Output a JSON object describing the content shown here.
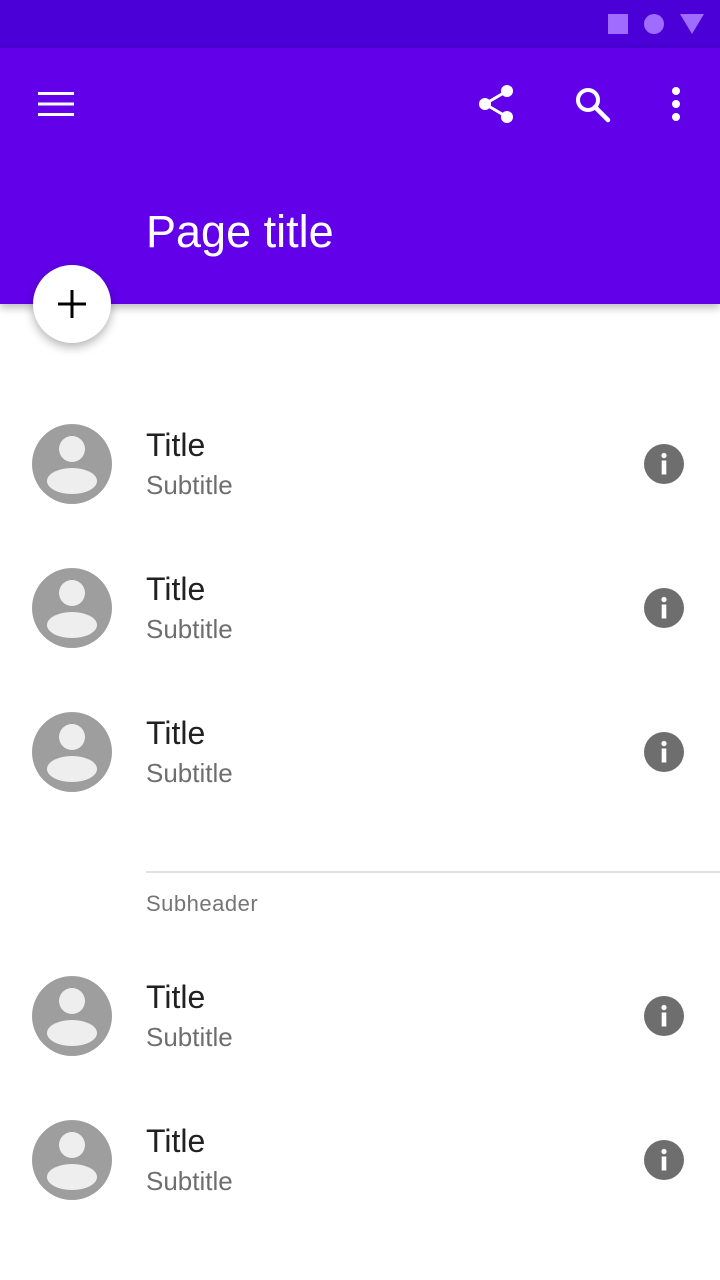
{
  "app_bar": {
    "title": "Page title",
    "background": "#6200ea",
    "icons": [
      "menu-icon",
      "share-icon",
      "search-icon",
      "more-vert-icon"
    ]
  },
  "status_bar": {
    "background": "#4a00d6",
    "icons": [
      "square-icon",
      "circle-icon",
      "triangle-icon"
    ]
  },
  "fab": {
    "icon": "add-icon"
  },
  "list": {
    "items": [
      {
        "title": "Title",
        "subtitle": "Subtitle"
      },
      {
        "title": "Title",
        "subtitle": "Subtitle"
      },
      {
        "title": "Title",
        "subtitle": "Subtitle"
      }
    ],
    "subheader": "Subheader",
    "items2": [
      {
        "title": "Title",
        "subtitle": "Subtitle"
      },
      {
        "title": "Title",
        "subtitle": "Subtitle"
      }
    ]
  }
}
